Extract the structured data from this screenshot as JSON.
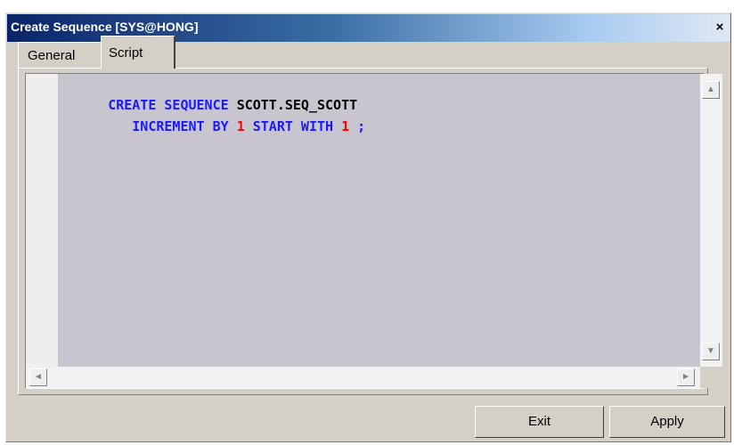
{
  "window": {
    "title": "Create Sequence [SYS@HONG]",
    "close_label": "×"
  },
  "tabs": [
    {
      "label": "General",
      "active": false
    },
    {
      "label": "Script",
      "active": true
    }
  ],
  "editor": {
    "lines": [
      [
        {
          "text": "CREATE SEQUENCE ",
          "kind": "keyword"
        },
        {
          "text": "SCOTT.SEQ_SCOTT",
          "kind": "identifier"
        }
      ],
      [
        {
          "text": "   INCREMENT BY ",
          "kind": "keyword"
        },
        {
          "text": "1",
          "kind": "number"
        },
        {
          "text": " START WITH ",
          "kind": "keyword"
        },
        {
          "text": "1",
          "kind": "number"
        },
        {
          "text": " ;",
          "kind": "keyword"
        }
      ]
    ],
    "colors": {
      "keyword": "#1a1aff",
      "identifier": "#000000",
      "number": "#ff0000",
      "background": "#c8c5cf"
    },
    "scroll_icons": [
      "scroll-up-icon",
      "scroll-down-icon",
      "scroll-left-icon",
      "scroll-right-icon"
    ]
  },
  "buttons": {
    "exit_label": "Exit",
    "apply_label": "Apply"
  }
}
